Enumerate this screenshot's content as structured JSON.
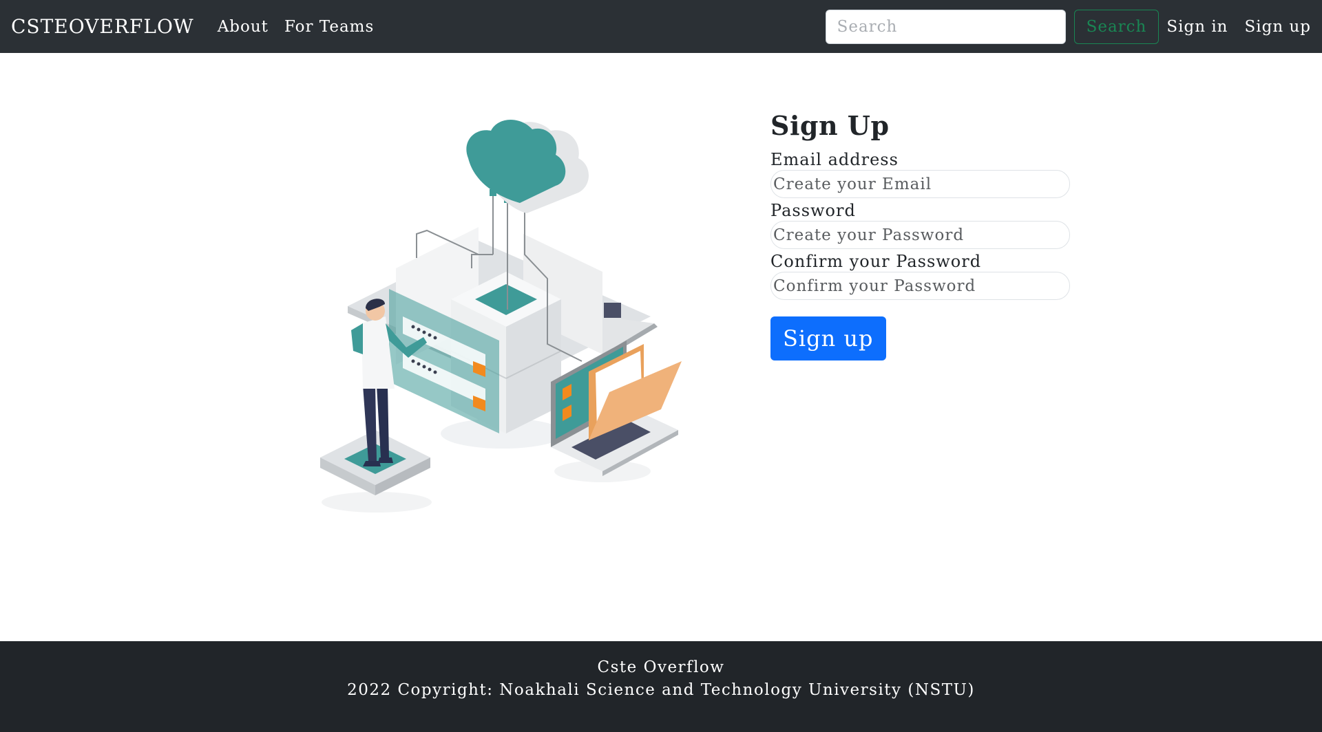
{
  "navbar": {
    "brand": "CSTEOVERFLOW",
    "links": [
      {
        "label": "About"
      },
      {
        "label": "For Teams"
      }
    ],
    "search": {
      "placeholder": "Search",
      "button_label": "Search"
    },
    "auth": {
      "sign_in": "Sign in",
      "sign_up": "Sign up"
    }
  },
  "form": {
    "title": "Sign Up",
    "fields": [
      {
        "label": "Email address",
        "placeholder": "Create your Email"
      },
      {
        "label": "Password",
        "placeholder": "Create your Password"
      },
      {
        "label": "Confirm your Password",
        "placeholder": "Confirm your Password"
      }
    ],
    "submit_label": "Sign up"
  },
  "footer": {
    "line1": "Cste Overflow",
    "line2": "2022 Copyright: Noakhali Science and Technology University (NSTU)"
  },
  "colors": {
    "navbar_bg": "#2b3035",
    "footer_bg": "#212529",
    "primary": "#0d6efd",
    "success": "#198754",
    "teal": "#3f9b98"
  }
}
